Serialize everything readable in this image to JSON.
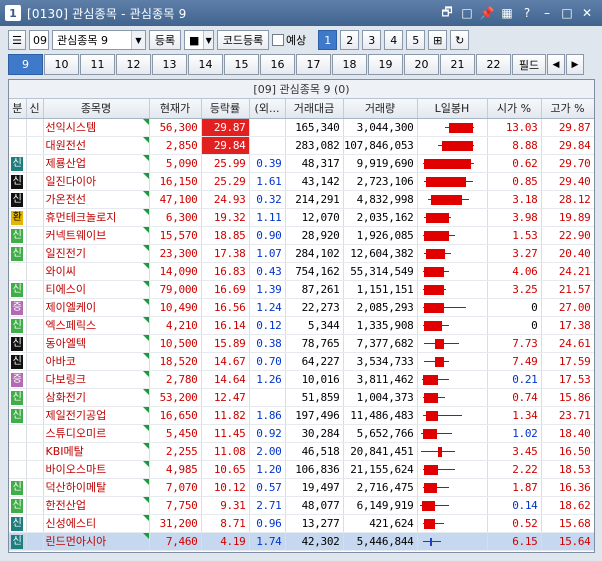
{
  "window": {
    "number": "1",
    "title": "[0130] 관심종목 - 관심종목 9"
  },
  "toolbar": {
    "group_no": "09",
    "group_select": "관심종목 9",
    "register": "등록",
    "code_register": "코드등록",
    "forecast": "예상",
    "pages": [
      "1",
      "2",
      "3",
      "4",
      "5"
    ],
    "active_page": "1"
  },
  "tabs": {
    "items": [
      "9",
      "10",
      "11",
      "12",
      "13",
      "14",
      "15",
      "16",
      "17",
      "18",
      "19",
      "20",
      "21",
      "22"
    ],
    "active": "9",
    "field": "필드"
  },
  "grid": {
    "caption": "[09] 관심종목 9 (0)",
    "headers": [
      "분",
      "신",
      "종목명",
      "현재가",
      "등락률",
      "(외...",
      "거래대금",
      "거래량",
      "L일봉H",
      "시가 %",
      "고가 %"
    ],
    "colors": {
      "up": "#d00000",
      "blue": "#0033cc",
      "highlight": "#e32020",
      "green_badge": "#3fae49",
      "black_badge": "#111111",
      "purple_badge": "#b36bb3",
      "yellow_badge": "#e3b700",
      "teal_badge": "#1e7d7d"
    },
    "rows": [
      {
        "flag": "",
        "flag_color": "",
        "name": "선익시스템",
        "price": "56,300",
        "rate": "29.87",
        "hl": true,
        "foreign": "",
        "amount": "165,340",
        "volume": "3,044,300",
        "candle_l": 0.45,
        "candle_r": 0.8,
        "wick_l": 0.4,
        "wick_r": 0.82,
        "candle_blue": false,
        "open": "13.03",
        "open_color": "up",
        "high": "29.87"
      },
      {
        "flag": "",
        "flag_color": "",
        "name": "대원전선",
        "price": "2,850",
        "rate": "29.84",
        "hl": true,
        "foreign": "",
        "amount": "283,082",
        "volume": "107,846,053",
        "candle_l": 0.35,
        "candle_r": 0.8,
        "wick_l": 0.3,
        "wick_r": 0.82,
        "candle_blue": false,
        "open": "8.88",
        "open_color": "up",
        "high": "29.84"
      },
      {
        "flag": "신",
        "flag_color": "teal",
        "name": "제룡산업",
        "price": "5,090",
        "rate": "25.99",
        "hl": false,
        "foreign": "0.39",
        "amount": "48,317",
        "volume": "9,919,690",
        "candle_l": 0.1,
        "candle_r": 0.78,
        "wick_l": 0.08,
        "wick_r": 0.82,
        "candle_blue": false,
        "open": "0.62",
        "open_color": "up",
        "high": "29.70"
      },
      {
        "flag": "신",
        "flag_color": "black",
        "name": "일진다이아",
        "price": "16,150",
        "rate": "25.29",
        "hl": false,
        "foreign": "1.61",
        "amount": "43,142",
        "volume": "2,723,106",
        "candle_l": 0.12,
        "candle_r": 0.7,
        "wick_l": 0.1,
        "wick_r": 0.8,
        "candle_blue": false,
        "open": "0.85",
        "open_color": "up",
        "high": "29.40"
      },
      {
        "flag": "신",
        "flag_color": "black",
        "name": "가온전선",
        "price": "47,100",
        "rate": "24.93",
        "hl": false,
        "foreign": "0.32",
        "amount": "214,291",
        "volume": "4,832,998",
        "candle_l": 0.2,
        "candle_r": 0.65,
        "wick_l": 0.15,
        "wick_r": 0.75,
        "candle_blue": false,
        "open": "3.18",
        "open_color": "up",
        "high": "28.12"
      },
      {
        "flag": "환",
        "flag_color": "yellow",
        "name": "휴먼테크놀로지",
        "price": "6,300",
        "rate": "19.32",
        "hl": false,
        "foreign": "1.11",
        "amount": "12,070",
        "volume": "2,035,162",
        "candle_l": 0.12,
        "candle_r": 0.45,
        "wick_l": 0.1,
        "wick_r": 0.48,
        "candle_blue": false,
        "open": "3.98",
        "open_color": "up",
        "high": "19.89"
      },
      {
        "flag": "신",
        "flag_color": "green",
        "name": "커넥트웨이브",
        "price": "15,570",
        "rate": "18.85",
        "hl": false,
        "foreign": "0.90",
        "amount": "28,920",
        "volume": "1,926,085",
        "candle_l": 0.1,
        "candle_r": 0.45,
        "wick_l": 0.08,
        "wick_r": 0.55,
        "candle_blue": false,
        "open": "1.53",
        "open_color": "up",
        "high": "22.90"
      },
      {
        "flag": "신",
        "flag_color": "green",
        "name": "일진전기",
        "price": "23,300",
        "rate": "17.38",
        "hl": false,
        "foreign": "1.07",
        "amount": "284,102",
        "volume": "12,604,382",
        "candle_l": 0.12,
        "candle_r": 0.4,
        "wick_l": 0.1,
        "wick_r": 0.48,
        "candle_blue": false,
        "open": "3.27",
        "open_color": "up",
        "high": "20.40"
      },
      {
        "flag": "",
        "flag_color": "",
        "name": "와이씨",
        "price": "14,090",
        "rate": "16.83",
        "hl": false,
        "foreign": "0.43",
        "amount": "754,162",
        "volume": "55,314,549",
        "candle_l": 0.1,
        "candle_r": 0.38,
        "wick_l": 0.08,
        "wick_r": 0.45,
        "candle_blue": false,
        "open": "4.06",
        "open_color": "up",
        "high": "24.21"
      },
      {
        "flag": "신",
        "flag_color": "green",
        "name": "티에스이",
        "price": "79,000",
        "rate": "16.69",
        "hl": false,
        "foreign": "1.39",
        "amount": "87,261",
        "volume": "1,151,151",
        "candle_l": 0.1,
        "candle_r": 0.38,
        "wick_l": 0.08,
        "wick_r": 0.42,
        "candle_blue": false,
        "open": "3.25",
        "open_color": "up",
        "high": "21.57"
      },
      {
        "flag": "증",
        "flag_color": "purple",
        "name": "제이엘케이",
        "price": "10,490",
        "rate": "16.56",
        "hl": false,
        "foreign": "1.24",
        "amount": "22,273",
        "volume": "2,085,293",
        "candle_l": 0.1,
        "candle_r": 0.38,
        "wick_l": 0.08,
        "wick_r": 0.7,
        "candle_blue": false,
        "open": "0",
        "open_color": "plain",
        "high": "27.00"
      },
      {
        "flag": "신",
        "flag_color": "green",
        "name": "엑스페릭스",
        "price": "4,210",
        "rate": "16.14",
        "hl": false,
        "foreign": "0.12",
        "amount": "5,344",
        "volume": "1,335,908",
        "candle_l": 0.1,
        "candle_r": 0.36,
        "wick_l": 0.08,
        "wick_r": 0.45,
        "candle_blue": false,
        "open": "0",
        "open_color": "plain",
        "high": "17.38"
      },
      {
        "flag": "신",
        "flag_color": "black",
        "name": "동아엘텍",
        "price": "10,500",
        "rate": "15.89",
        "hl": false,
        "foreign": "0.38",
        "amount": "78,765",
        "volume": "7,377,682",
        "candle_l": 0.25,
        "candle_r": 0.38,
        "wick_l": 0.1,
        "wick_r": 0.6,
        "candle_blue": false,
        "open": "7.73",
        "open_color": "up",
        "high": "24.61"
      },
      {
        "flag": "신",
        "flag_color": "black",
        "name": "아바코",
        "price": "18,520",
        "rate": "14.67",
        "hl": false,
        "foreign": "0.70",
        "amount": "64,227",
        "volume": "3,534,733",
        "candle_l": 0.25,
        "candle_r": 0.38,
        "wick_l": 0.1,
        "wick_r": 0.45,
        "candle_blue": false,
        "open": "7.49",
        "open_color": "up",
        "high": "17.59"
      },
      {
        "flag": "증",
        "flag_color": "purple",
        "name": "다보링크",
        "price": "2,780",
        "rate": "14.64",
        "hl": false,
        "foreign": "1.26",
        "amount": "10,016",
        "volume": "3,811,462",
        "candle_l": 0.08,
        "candle_r": 0.3,
        "wick_l": 0.06,
        "wick_r": 0.45,
        "candle_blue": false,
        "open": "0.21",
        "open_color": "blue",
        "high": "17.53"
      },
      {
        "flag": "신",
        "flag_color": "green",
        "name": "삼화전기",
        "price": "53,200",
        "rate": "12.47",
        "hl": false,
        "foreign": "",
        "amount": "51,859",
        "volume": "1,004,373",
        "candle_l": 0.1,
        "candle_r": 0.3,
        "wick_l": 0.08,
        "wick_r": 0.4,
        "candle_blue": false,
        "open": "0.74",
        "open_color": "up",
        "high": "15.86"
      },
      {
        "flag": "신",
        "flag_color": "green",
        "name": "제일전기공업",
        "price": "16,650",
        "rate": "11.82",
        "hl": false,
        "foreign": "1.86",
        "amount": "197,496",
        "volume": "11,486,483",
        "candle_l": 0.12,
        "candle_r": 0.3,
        "wick_l": 0.08,
        "wick_r": 0.65,
        "candle_blue": false,
        "open": "1.34",
        "open_color": "up",
        "high": "23.71"
      },
      {
        "flag": "",
        "flag_color": "",
        "name": "스튜디오미르",
        "price": "5,450",
        "rate": "11.45",
        "hl": false,
        "foreign": "0.92",
        "amount": "30,284",
        "volume": "5,652,766",
        "candle_l": 0.08,
        "candle_r": 0.28,
        "wick_l": 0.05,
        "wick_r": 0.5,
        "candle_blue": false,
        "open": "1.02",
        "open_color": "blue",
        "high": "18.40"
      },
      {
        "flag": "",
        "flag_color": "",
        "name": "KBI메탈",
        "price": "2,255",
        "rate": "11.08",
        "hl": false,
        "foreign": "2.00",
        "amount": "46,518",
        "volume": "20,841,451",
        "candle_l": 0.3,
        "candle_r": 0.35,
        "wick_l": 0.05,
        "wick_r": 0.55,
        "candle_blue": false,
        "open": "3.45",
        "open_color": "up",
        "high": "16.50"
      },
      {
        "flag": "",
        "flag_color": "",
        "name": "바이오스마트",
        "price": "4,985",
        "rate": "10.65",
        "hl": false,
        "foreign": "1.20",
        "amount": "106,836",
        "volume": "21,155,624",
        "candle_l": 0.1,
        "candle_r": 0.3,
        "wick_l": 0.08,
        "wick_r": 0.55,
        "candle_blue": false,
        "open": "2.22",
        "open_color": "up",
        "high": "18.53"
      },
      {
        "flag": "신",
        "flag_color": "green",
        "name": "덕산하이메탈",
        "price": "7,070",
        "rate": "10.12",
        "hl": false,
        "foreign": "0.57",
        "amount": "19,497",
        "volume": "2,716,475",
        "candle_l": 0.1,
        "candle_r": 0.28,
        "wick_l": 0.08,
        "wick_r": 0.45,
        "candle_blue": false,
        "open": "1.87",
        "open_color": "up",
        "high": "16.36"
      },
      {
        "flag": "신",
        "flag_color": "green",
        "name": "한전산업",
        "price": "7,750",
        "rate": "9.31",
        "hl": false,
        "foreign": "2.71",
        "amount": "48,077",
        "volume": "6,149,919",
        "candle_l": 0.06,
        "candle_r": 0.26,
        "wick_l": 0.04,
        "wick_r": 0.45,
        "candle_blue": false,
        "open": "0.14",
        "open_color": "blue",
        "high": "18.62"
      },
      {
        "flag": "신",
        "flag_color": "teal",
        "name": "신성에스티",
        "price": "31,200",
        "rate": "8.71",
        "hl": false,
        "foreign": "0.96",
        "amount": "13,277",
        "volume": "421,624",
        "candle_l": 0.1,
        "candle_r": 0.26,
        "wick_l": 0.08,
        "wick_r": 0.38,
        "candle_blue": false,
        "open": "0.52",
        "open_color": "up",
        "high": "15.68"
      },
      {
        "flag": "신",
        "flag_color": "teal",
        "name": "린드먼아시아",
        "price": "7,460",
        "rate": "4.19",
        "hl": false,
        "foreign": "1.74",
        "amount": "42,302",
        "volume": "5,446,844",
        "candle_l": 0.18,
        "candle_r": 0.2,
        "wick_l": 0.08,
        "wick_r": 0.34,
        "candle_blue": true,
        "open": "6.15",
        "open_color": "up",
        "high": "15.64",
        "selected": true
      }
    ]
  }
}
